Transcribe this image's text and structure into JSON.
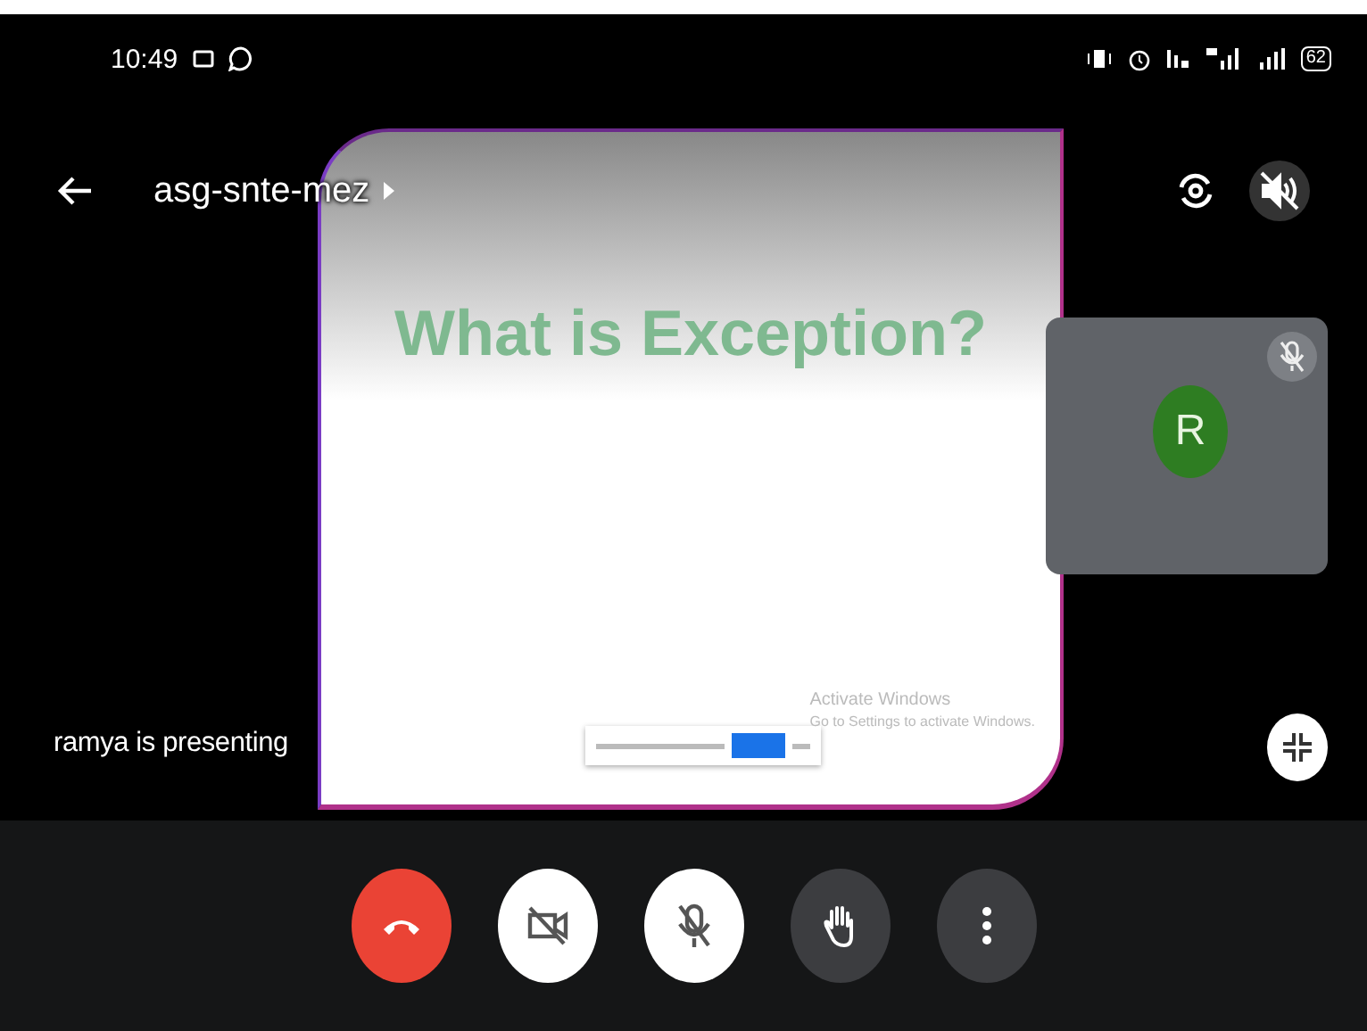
{
  "status_bar": {
    "time": "10:49",
    "battery": "62"
  },
  "meeting": {
    "title": "asg-snte-mez",
    "speaker_muted": true
  },
  "slide": {
    "title": "What is Exception?",
    "watermark_title": "Activate Windows",
    "watermark_text": "Go to Settings to activate Windows."
  },
  "presenter_label": "ramya is presenting",
  "participant": {
    "initial": "R",
    "color": "#2e7d22",
    "muted": true
  },
  "controls": [
    {
      "kind": "hangup"
    },
    {
      "kind": "camera",
      "on": false
    },
    {
      "kind": "mic",
      "on": false
    },
    {
      "kind": "hand"
    },
    {
      "kind": "more"
    }
  ]
}
